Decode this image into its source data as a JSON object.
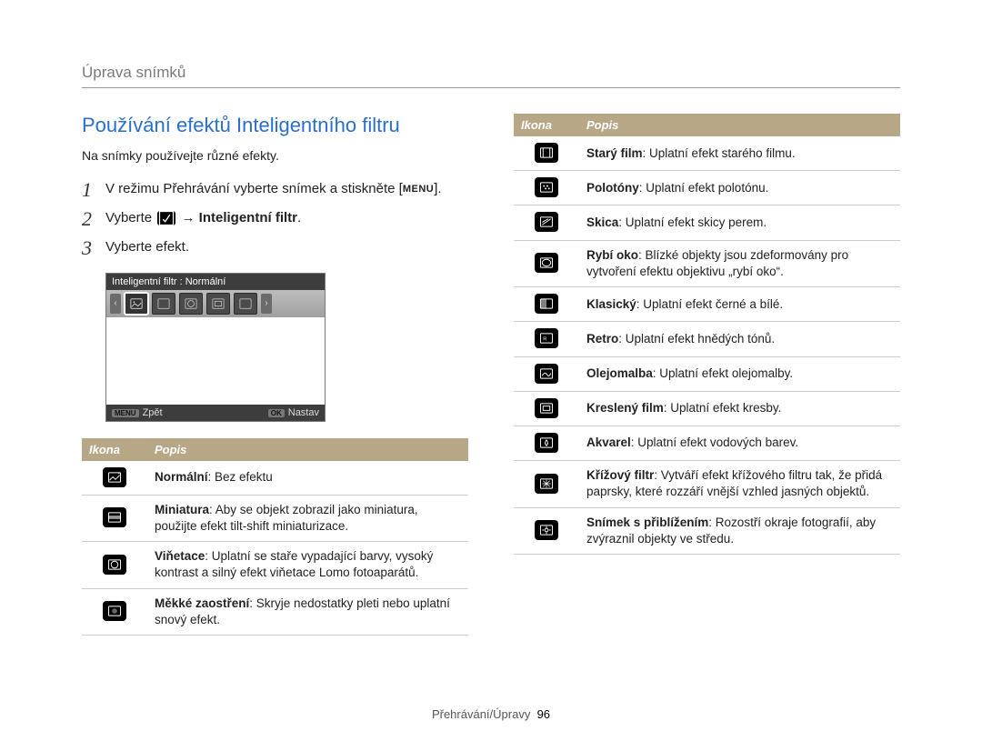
{
  "header": {
    "title": "Úprava snímků"
  },
  "section": {
    "title": "Používání efektů Inteligentního filtru",
    "intro": "Na snímky používejte různé efekty."
  },
  "steps": [
    {
      "num": "1",
      "pre": "V režimu Přehrávání vyberte snímek a stiskněte [",
      "btn": "MENU",
      "post": "]."
    },
    {
      "num": "2",
      "pre": "Vyberte ",
      "arrow": " → ",
      "bold": "Inteligentní filtr",
      "post": "."
    },
    {
      "num": "3",
      "pre": "Vyberte efekt.",
      "post": ""
    }
  ],
  "screen": {
    "title": "Inteligentní filtr : Normální",
    "back_btn": "MENU",
    "back_label": "Zpět",
    "ok_btn": "OK",
    "ok_label": "Nastav"
  },
  "table_head": {
    "icon": "Ikona",
    "desc": "Popis"
  },
  "left_effects": [
    {
      "icon": "normal",
      "name": "Normální",
      "desc": ": Bez efektu"
    },
    {
      "icon": "mini",
      "name": "Miniatura",
      "desc": ": Aby se objekt zobrazil jako miniatura, použijte efekt tilt-shift miniaturizace."
    },
    {
      "icon": "vignette",
      "name": "Viňetace",
      "desc": ": Uplatní se staře vypadající barvy, vysoký kontrast a silný efekt viňetace Lomo fotoaparátů."
    },
    {
      "icon": "soft",
      "name": "Měkké zaostření",
      "desc": ": Skryje nedostatky pleti nebo uplatní snový efekt."
    }
  ],
  "right_effects": [
    {
      "icon": "oldfilm",
      "name": "Starý film",
      "desc": ": Uplatní efekt starého filmu."
    },
    {
      "icon": "halftone",
      "name": "Polotóny",
      "desc": ": Uplatní efekt polotónu."
    },
    {
      "icon": "sketch",
      "name": "Skica",
      "desc": ": Uplatní efekt skicy perem."
    },
    {
      "icon": "fisheye",
      "name": "Rybí oko",
      "desc": ": Blízké objekty jsou zdeformovány pro vytvoření efektu objektivu „rybí oko“."
    },
    {
      "icon": "classic",
      "name": "Klasický",
      "desc": ": Uplatní efekt černé a bílé."
    },
    {
      "icon": "retro",
      "name": "Retro",
      "desc": ": Uplatní efekt hnědých tónů."
    },
    {
      "icon": "oil",
      "name": "Olejomalba",
      "desc": ": Uplatní efekt olejomalby."
    },
    {
      "icon": "cartoon",
      "name": "Kreslený film",
      "desc": ": Uplatní efekt kresby."
    },
    {
      "icon": "water",
      "name": "Akvarel",
      "desc": ": Uplatní efekt vodových barev."
    },
    {
      "icon": "cross",
      "name": "Křížový filtr",
      "desc": ": Vytváří efekt křížového filtru tak, že přidá paprsky, které rozzáří vnější vzhled jasných objektů."
    },
    {
      "icon": "zoom",
      "name": "Snímek s přiblížením",
      "desc": ": Rozostří okraje fotografií, aby zvýraznil objekty ve středu."
    }
  ],
  "footer": {
    "section": "Přehrávání/Úpravy",
    "page": "96"
  }
}
